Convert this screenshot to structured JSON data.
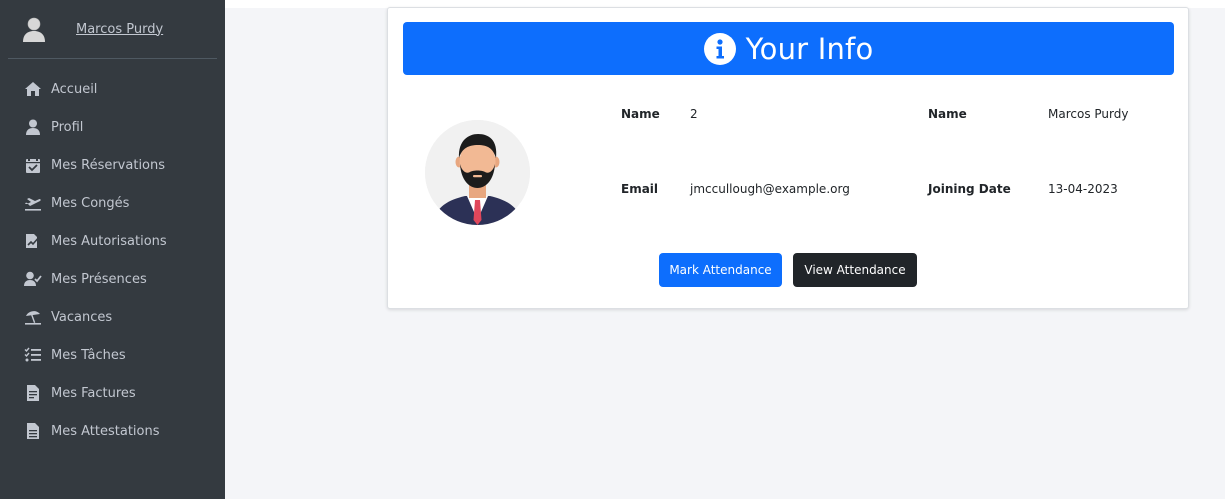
{
  "user": {
    "name": "Marcos Purdy"
  },
  "sidebar": {
    "items": [
      {
        "label": "Accueil",
        "icon": "home-icon"
      },
      {
        "label": "Profil",
        "icon": "user-icon"
      },
      {
        "label": "Mes Réservations",
        "icon": "calendar-check-icon"
      },
      {
        "label": "Mes Congés",
        "icon": "plane-departure-icon"
      },
      {
        "label": "Mes Autorisations",
        "icon": "file-signature-icon"
      },
      {
        "label": "Mes Présences",
        "icon": "user-check-icon"
      },
      {
        "label": "Vacances",
        "icon": "umbrella-beach-icon"
      },
      {
        "label": "Mes Tâches",
        "icon": "tasks-icon"
      },
      {
        "label": "Mes Factures",
        "icon": "file-invoice-icon"
      },
      {
        "label": "Mes Attestations",
        "icon": "file-alt-icon"
      }
    ]
  },
  "card": {
    "title": "Your Info",
    "icon": "info-circle-icon",
    "fields": {
      "name_label": "Name",
      "name_value": "2",
      "name2_label": "Name",
      "name2_value": "Marcos Purdy",
      "email_label": "Email",
      "email_value": "jmccullough@example.org",
      "joining_label": "Joining Date",
      "joining_value": "13-04-2023"
    },
    "buttons": {
      "mark": "Mark Attendance",
      "view": "View Attendance"
    }
  },
  "colors": {
    "sidebar_bg": "#343a40",
    "primary": "#0d6efd",
    "dark": "#212529",
    "page_bg": "#f4f5f8"
  }
}
